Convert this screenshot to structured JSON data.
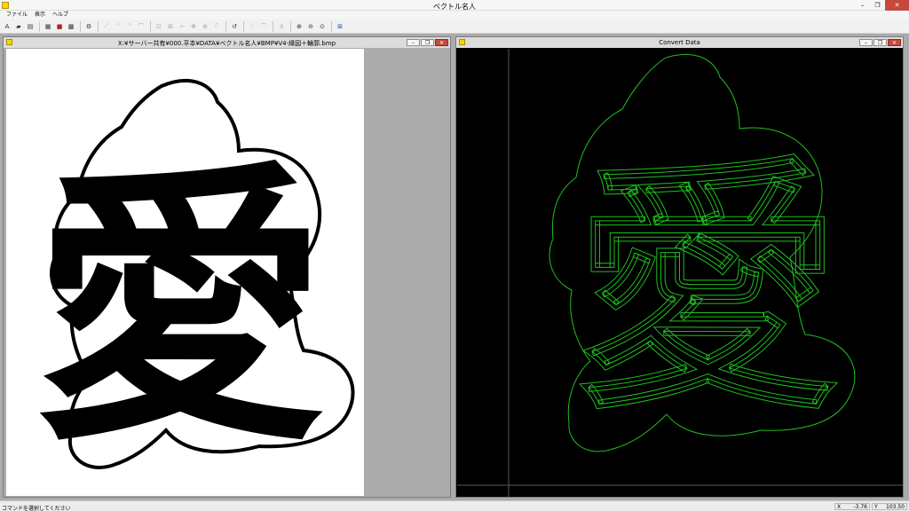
{
  "app": {
    "title": "ベクトル名人"
  },
  "window_controls": {
    "minimize": "–",
    "restore": "❐",
    "close": "✕"
  },
  "menu": [
    "ファイル",
    "表示",
    "ヘルプ"
  ],
  "toolbar": {
    "icons": [
      "new-icon",
      "open-icon",
      "print-icon",
      "view-image-icon",
      "view-vector-icon",
      "bitmap-icon",
      "line-tool-icon",
      "curve-tool-icon",
      "corner-tool-icon",
      "edit-node-icon",
      "move-icon",
      "zoom-in-icon",
      "zoom-out-icon",
      "fit-icon",
      "convert-icon"
    ]
  },
  "left_window": {
    "title": "X:¥サーバー共有¥000.平本¥DATA¥ベクトル名人¥BMP¥V4-縁図＋輪郭.bmp",
    "glyph": "愛"
  },
  "right_window": {
    "title": "Convert Data",
    "glyph": "愛",
    "outline_color": "#1fbf1f"
  },
  "child_buttons": {
    "minimize": "–",
    "restore": "❐",
    "close": "✕"
  },
  "status": {
    "message": "コマンドを選択してください",
    "x_label": "X",
    "x_value": "-3.76",
    "y_label": "Y",
    "y_value": "103.50"
  }
}
